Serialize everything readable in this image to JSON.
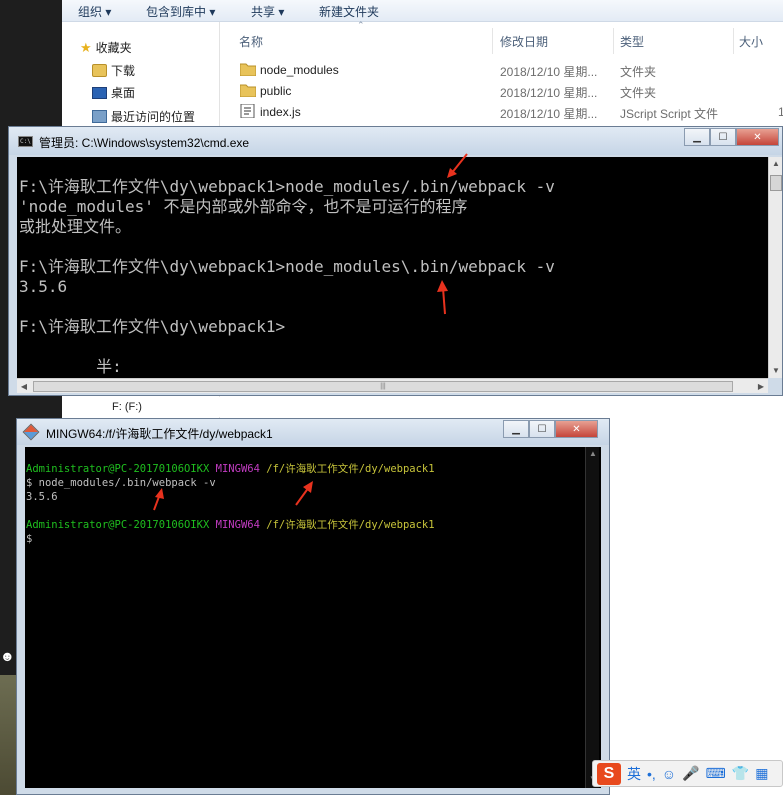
{
  "explorer": {
    "toolbar": [
      "组织",
      "包含到库中",
      "共享",
      "新建文件夹"
    ],
    "nav": {
      "favorites": "收藏夹",
      "downloads": "下载",
      "desktop": "桌面",
      "recent": "最近访问的位置",
      "drive_f": "F: (F:)"
    },
    "columns": {
      "name": "名称",
      "modified": "修改日期",
      "type": "类型",
      "size": "大小"
    },
    "rows": [
      {
        "name": "node_modules",
        "modified": "2018/12/10 星期...",
        "type": "文件夹",
        "size": ""
      },
      {
        "name": "public",
        "modified": "2018/12/10 星期...",
        "type": "文件夹",
        "size": ""
      },
      {
        "name": "index.js",
        "modified": "2018/12/10 星期...",
        "type": "JScript Script 文件",
        "size": "1"
      }
    ]
  },
  "cmd": {
    "title": "管理员: C:\\Windows\\system32\\cmd.exe",
    "lines": [
      "",
      "F:\\许海耿工作文件\\dy\\webpack1>node_modules/.bin/webpack -v",
      "'node_modules' 不是内部或外部命令，也不是可运行的程序",
      "或批处理文件。",
      "",
      "F:\\许海耿工作文件\\dy\\webpack1>node_modules\\.bin/webpack -v",
      "3.5.6",
      "",
      "F:\\许海耿工作文件\\dy\\webpack1>",
      "",
      "        半:"
    ]
  },
  "mingw": {
    "title": "MINGW64:/f/许海耿工作文件/dy/webpack1",
    "prompt_user": "Administrator@PC-20170106OIKX",
    "prompt_env": "MINGW64",
    "prompt_path": "/f/许海耿工作文件/dy/webpack1",
    "command": "$ node_modules/.bin/webpack -v",
    "output": "3.5.6",
    "prompt_end": "$"
  },
  "ime": {
    "logo": "S",
    "mode": "英",
    "punct": "•,",
    "emoji": "☺",
    "voice": "🎤",
    "keyboard": "⌨",
    "skin": "👕",
    "tools": "▦"
  },
  "colors": {
    "annotation_arrow": "#e8321e",
    "bash_green": "#1fbf1f",
    "bash_magenta": "#c23cc2",
    "bash_yellow": "#c7c43a"
  }
}
